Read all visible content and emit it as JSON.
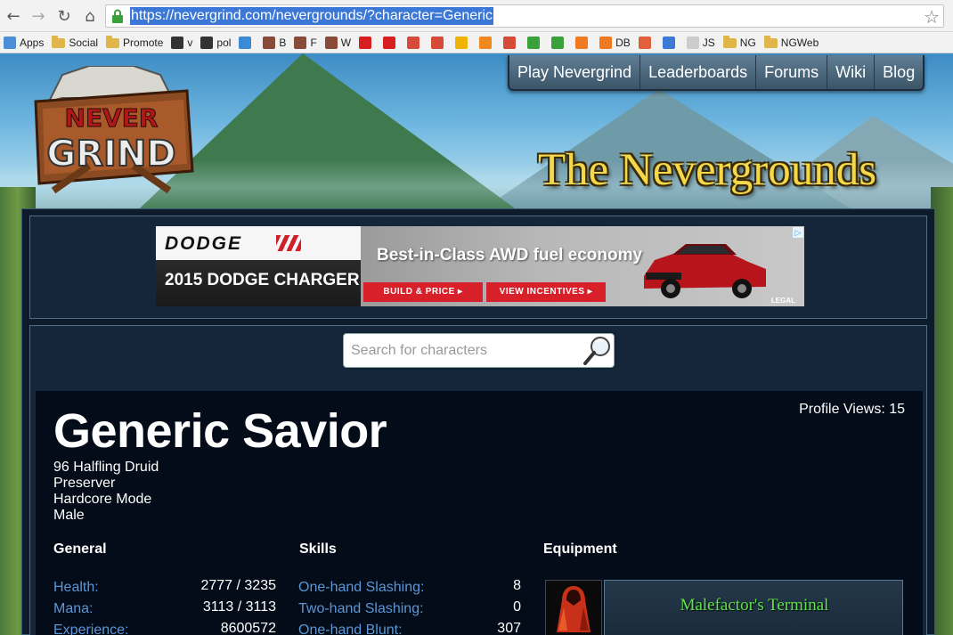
{
  "browser": {
    "url_text": "https://nevergrind.com/nevergrounds/?character=Generic",
    "bookmarks": [
      {
        "label": "Apps",
        "icon": "apps-grid-icon",
        "color": "#4a90d9"
      },
      {
        "label": "Social",
        "icon": "folder-icon",
        "color": "#e0b64a"
      },
      {
        "label": "Promote",
        "icon": "folder-icon",
        "color": "#e0b64a"
      },
      {
        "label": "v",
        "icon": "infinity-icon",
        "color": "#333333"
      },
      {
        "label": "pol",
        "icon": "infinity-icon",
        "color": "#333333"
      },
      {
        "label": "",
        "icon": "s-letter-icon",
        "color": "#3a8ad6"
      },
      {
        "label": "B",
        "icon": "bookmark-brown-icon",
        "color": "#8a4a3a"
      },
      {
        "label": "F",
        "icon": "bookmark-brown-icon",
        "color": "#8a4a3a"
      },
      {
        "label": "W",
        "icon": "bookmark-brown-icon",
        "color": "#8a4a3a"
      },
      {
        "label": "",
        "icon": "youtube-icon",
        "color": "#d62020"
      },
      {
        "label": "",
        "icon": "youtube-icon",
        "color": "#d62020"
      },
      {
        "label": "",
        "icon": "gmail-icon",
        "color": "#d64a3a"
      },
      {
        "label": "",
        "icon": "gmail-icon",
        "color": "#d64a3a"
      },
      {
        "label": "",
        "icon": "adsense-icon",
        "color": "#f0b400"
      },
      {
        "label": "",
        "icon": "analytics-icon",
        "color": "#f08a20"
      },
      {
        "label": "",
        "icon": "google-plus-icon",
        "color": "#d64a3a"
      },
      {
        "label": "",
        "icon": "green-square-icon",
        "color": "#3aa03a"
      },
      {
        "label": "",
        "icon": "green-square-icon",
        "color": "#3aa03a"
      },
      {
        "label": "",
        "icon": "cpanel-icon",
        "color": "#f07a20"
      },
      {
        "label": "DB",
        "icon": "cpanel-icon",
        "color": "#f07a20"
      },
      {
        "label": "",
        "icon": "html-icon",
        "color": "#e0603a"
      },
      {
        "label": "",
        "icon": "css-icon",
        "color": "#3a7ad6"
      },
      {
        "label": "JS",
        "icon": "page-icon",
        "color": "#cccccc"
      },
      {
        "label": "NG",
        "icon": "folder-icon",
        "color": "#e0b64a"
      },
      {
        "label": "NGWeb",
        "icon": "folder-icon",
        "color": "#e0b64a"
      }
    ]
  },
  "site": {
    "logo_top": "NEVER",
    "logo_bottom": "GRIND",
    "nav": [
      "Play Nevergrind",
      "Leaderboards",
      "Forums",
      "Wiki",
      "Blog"
    ],
    "title": "The Nevergrounds"
  },
  "ad": {
    "brand": "DODGE",
    "model": "2015 DODGE CHARGER",
    "headline": "Best-in-Class AWD fuel economy",
    "button_1": "BUILD & PRICE ▸",
    "button_2": "VIEW INCENTIVES ▸",
    "legal": "LEGAL",
    "choice_icon": "ad-choices-icon"
  },
  "search": {
    "placeholder": "Search for characters"
  },
  "character": {
    "name": "Generic Savior",
    "profile_views": "Profile Views: 15",
    "details": [
      "96 Halfling Druid",
      "Preserver",
      "Hardcore Mode",
      "Male"
    ]
  },
  "columns": {
    "general": "General",
    "skills": "Skills",
    "equipment": "Equipment"
  },
  "general_stats": [
    {
      "label": "Health:",
      "value": "2777 / 3235"
    },
    {
      "label": "Mana:",
      "value": "3113 / 3113"
    },
    {
      "label": "Experience:",
      "value": "8600572"
    }
  ],
  "skills": [
    {
      "label": "One-hand Slashing:",
      "value": "8"
    },
    {
      "label": "Two-hand Slashing:",
      "value": "0"
    },
    {
      "label": "One-hand Blunt:",
      "value": "307"
    }
  ],
  "equipment": [
    {
      "name": "Malefactor's Terminal",
      "icon": "red-robe-icon"
    }
  ]
}
